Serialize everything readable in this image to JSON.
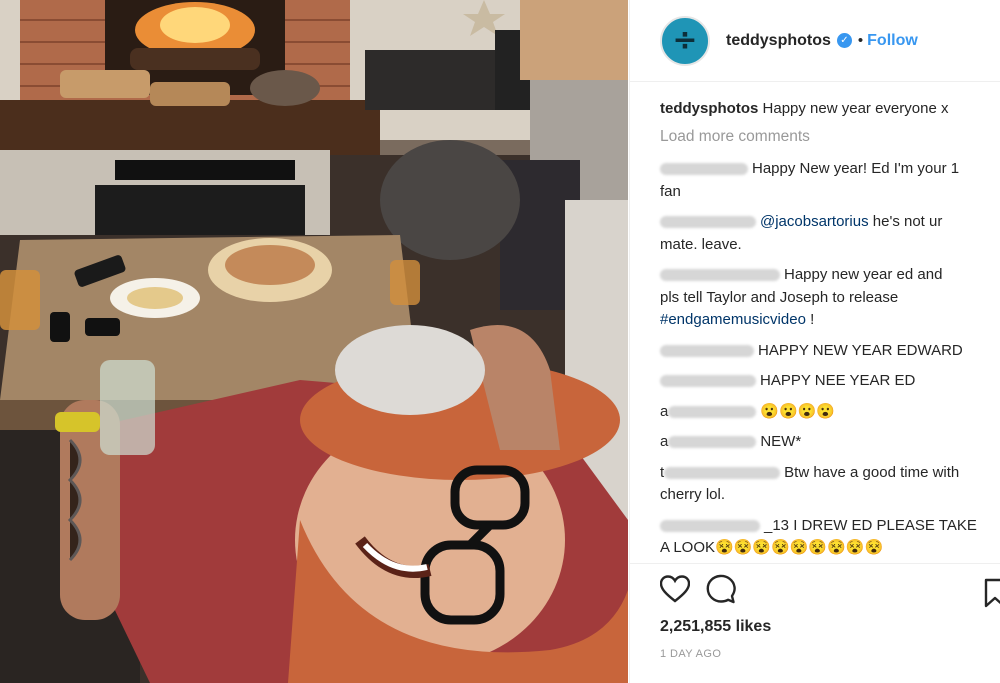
{
  "post": {
    "username": "teddysphotos",
    "verified_badge": "✓",
    "separator": "•",
    "follow_label": "Follow",
    "avatar_symbol": "÷"
  },
  "caption": {
    "username": "teddysphotos",
    "text": "Happy new year everyone x"
  },
  "load_more_label": "Load more comments",
  "comments": [
    {
      "prefix": "",
      "text": "Happy New year! Ed I'm your 1",
      "text2": "fan"
    },
    {
      "prefix": "",
      "mention": "@jacobsartorius",
      "text": "he's not ur",
      "text2": "mate. leave."
    },
    {
      "prefix": "",
      "text": "Happy new year ed and",
      "text2": "pls tell Taylor and Joseph to release",
      "hashtag": "#endgamemusicvideo",
      "tail": "!"
    },
    {
      "prefix": "",
      "text": "HAPPY NEW YEAR EDWARD"
    },
    {
      "prefix": "",
      "text": "HAPPY NEE YEAR ED"
    },
    {
      "prefix": "a",
      "text": "😮😮😮😮"
    },
    {
      "prefix": "a",
      "text": "NEW*"
    },
    {
      "prefix": "t",
      "text": "Btw have a good time with",
      "text2": "cherry lol."
    },
    {
      "prefix": "",
      "text": "_13 I DREW ED PLEASE TAKE",
      "text2": "A LOOK😵😵😵😵😵😵😵😵😵"
    }
  ],
  "likes": "2,251,855 likes",
  "timestamp": "1 DAY AGO",
  "icons": {
    "like": "heart-icon",
    "comment": "comment-icon",
    "save": "bookmark-icon"
  },
  "colors": {
    "accent": "#3897f0",
    "username": "#262626",
    "muted": "#999999",
    "link": "#003569"
  }
}
